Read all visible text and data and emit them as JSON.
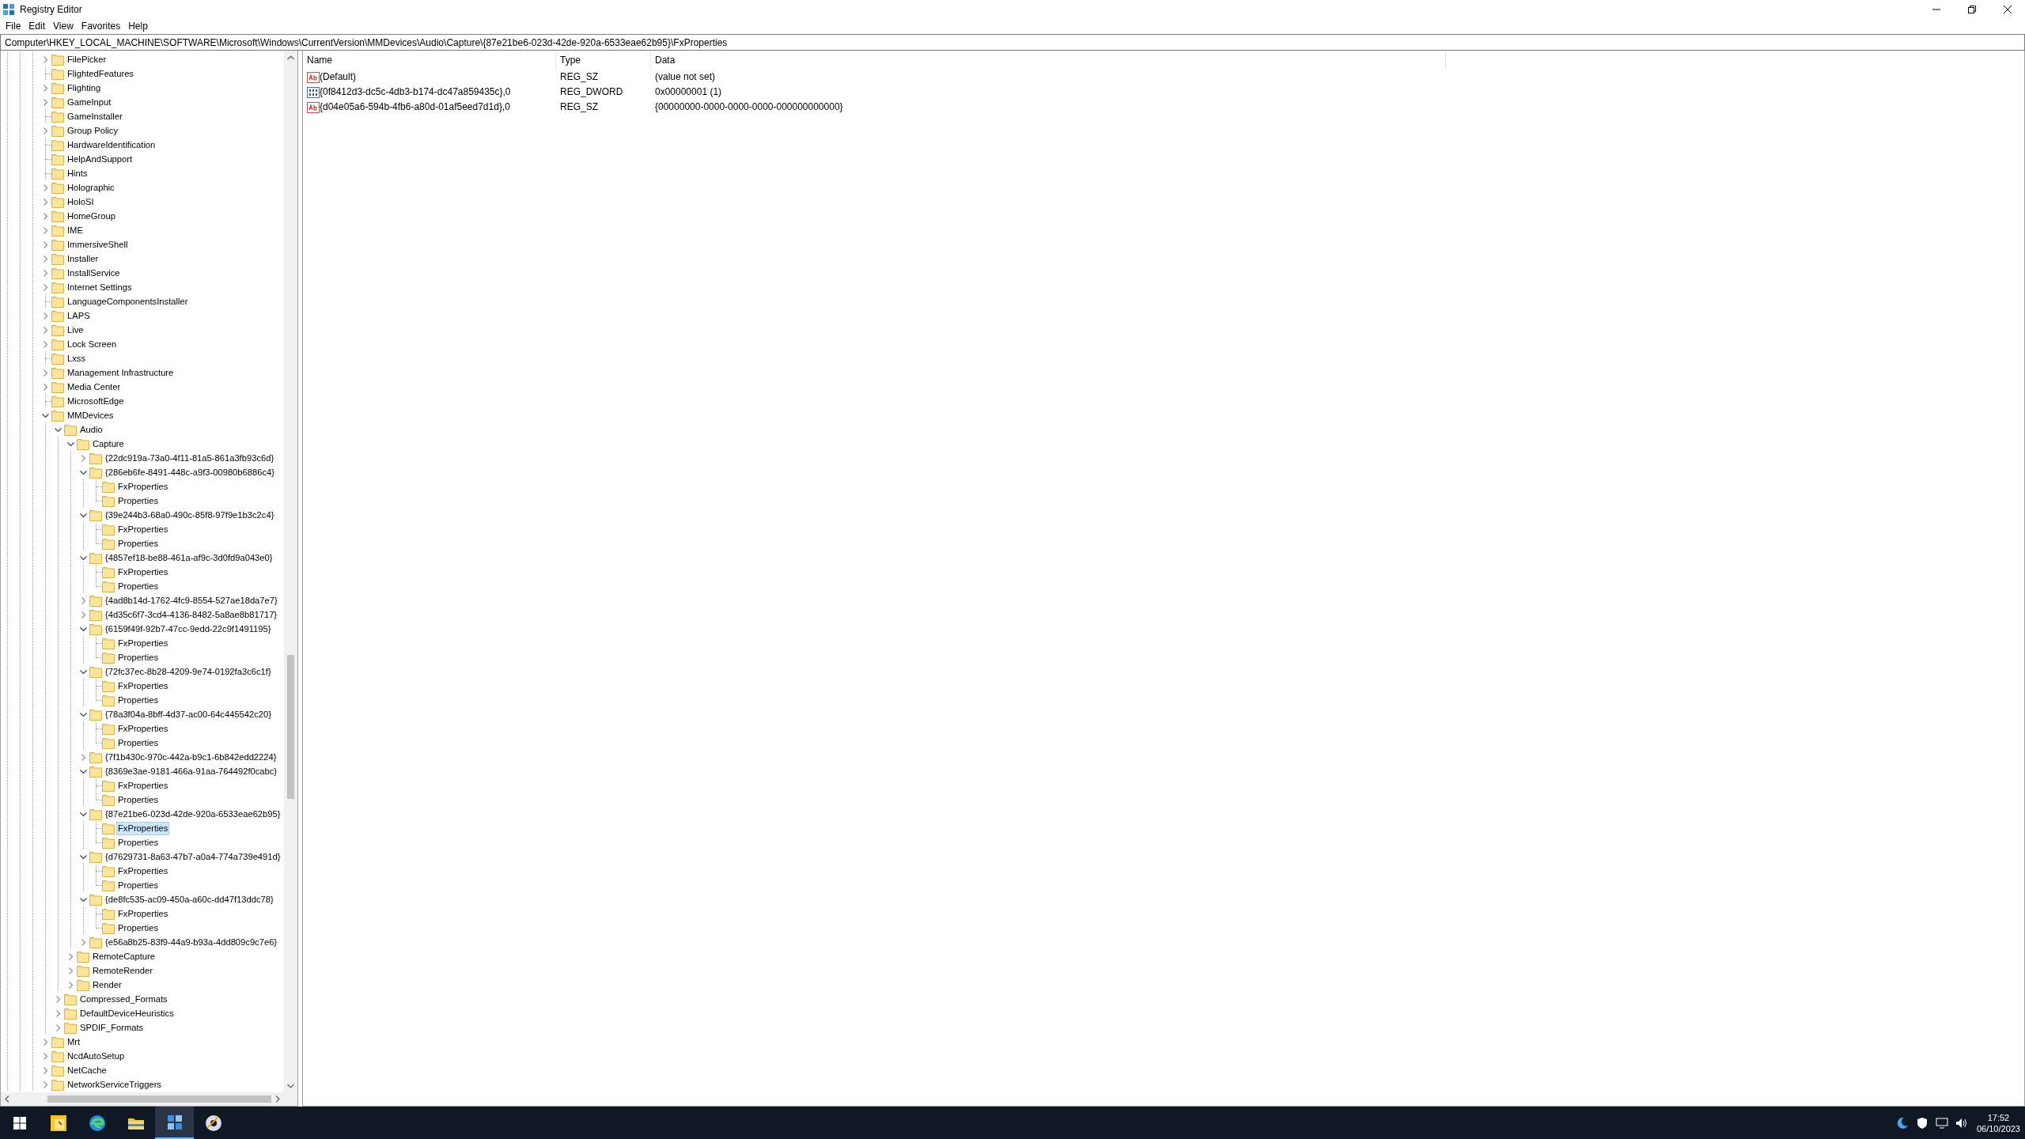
{
  "window": {
    "title": "Registry Editor"
  },
  "menu": [
    "File",
    "Edit",
    "View",
    "Favorites",
    "Help"
  ],
  "address_bar": {
    "value": "Computer\\HKEY_LOCAL_MACHINE\\SOFTWARE\\Microsoft\\Windows\\CurrentVersion\\MMDevices\\Audio\\Capture\\{87e21be6-023d-42de-920a-6533eae62b95}\\FxProperties"
  },
  "tree": {
    "items": [
      {
        "name": "FilePicker",
        "kind": "branch",
        "expanded": false,
        "selected": false
      },
      {
        "name": "FlightedFeatures",
        "kind": "leaf",
        "selected": false
      },
      {
        "name": "Flighting",
        "kind": "branch",
        "expanded": false,
        "selected": false
      },
      {
        "name": "GameInput",
        "kind": "branch",
        "expanded": false,
        "selected": false
      },
      {
        "name": "GameInstaller",
        "kind": "leaf",
        "selected": false
      },
      {
        "name": "Group Policy",
        "kind": "branch",
        "expanded": false,
        "selected": false
      },
      {
        "name": "HardwareIdentification",
        "kind": "leaf",
        "selected": false
      },
      {
        "name": "HelpAndSupport",
        "kind": "leaf",
        "selected": false
      },
      {
        "name": "Hints",
        "kind": "leaf",
        "selected": false
      },
      {
        "name": "Holographic",
        "kind": "branch",
        "expanded": false,
        "selected": false
      },
      {
        "name": "HoloSI",
        "kind": "branch",
        "expanded": false,
        "selected": false
      },
      {
        "name": "HomeGroup",
        "kind": "branch",
        "expanded": false,
        "selected": false
      },
      {
        "name": "IME",
        "kind": "branch",
        "expanded": false,
        "selected": false
      },
      {
        "name": "ImmersiveShell",
        "kind": "branch",
        "expanded": false,
        "selected": false
      },
      {
        "name": "Installer",
        "kind": "branch",
        "expanded": false,
        "selected": false
      },
      {
        "name": "InstallService",
        "kind": "branch",
        "expanded": false,
        "selected": false
      },
      {
        "name": "Internet Settings",
        "kind": "branch",
        "expanded": false,
        "selected": false
      },
      {
        "name": "LanguageComponentsInstaller",
        "kind": "leaf",
        "selected": false
      },
      {
        "name": "LAPS",
        "kind": "branch",
        "expanded": false,
        "selected": false
      },
      {
        "name": "Live",
        "kind": "branch",
        "expanded": false,
        "selected": false
      },
      {
        "name": "Lock Screen",
        "kind": "branch",
        "expanded": false,
        "selected": false
      },
      {
        "name": "Lxss",
        "kind": "leaf",
        "selected": false
      },
      {
        "name": "Management Infrastructure",
        "kind": "branch",
        "expanded": false,
        "selected": false
      },
      {
        "name": "Media Center",
        "kind": "branch",
        "expanded": false,
        "selected": false
      },
      {
        "name": "MicrosoftEdge",
        "kind": "leaf",
        "selected": false
      },
      {
        "name": "MMDevices",
        "kind": "branch",
        "expanded": true,
        "selected": false,
        "children": [
          {
            "name": "Audio",
            "kind": "branch",
            "expanded": true,
            "selected": false,
            "children": [
              {
                "name": "Capture",
                "kind": "branch",
                "expanded": true,
                "selected": false,
                "children": [
                  {
                    "name": "{22dc919a-73a0-4f11-81a5-861a3fb93c6d}",
                    "kind": "branch",
                    "expanded": false,
                    "selected": false
                  },
                  {
                    "name": "{286eb6fe-8491-448c-a9f3-00980b6886c4}",
                    "kind": "branch",
                    "expanded": true,
                    "selected": false,
                    "children": [
                      {
                        "name": "FxProperties",
                        "kind": "leaf",
                        "selected": false
                      },
                      {
                        "name": "Properties",
                        "kind": "leaf",
                        "selected": false
                      }
                    ]
                  },
                  {
                    "name": "{39e244b3-68a0-490c-85f8-97f9e1b3c2c4}",
                    "kind": "branch",
                    "expanded": true,
                    "selected": false,
                    "children": [
                      {
                        "name": "FxProperties",
                        "kind": "leaf",
                        "selected": false
                      },
                      {
                        "name": "Properties",
                        "kind": "leaf",
                        "selected": false
                      }
                    ]
                  },
                  {
                    "name": "{4857ef18-be88-461a-af9c-3d0fd9a043e0}",
                    "kind": "branch",
                    "expanded": true,
                    "selected": false,
                    "children": [
                      {
                        "name": "FxProperties",
                        "kind": "leaf",
                        "selected": false
                      },
                      {
                        "name": "Properties",
                        "kind": "leaf",
                        "selected": false
                      }
                    ]
                  },
                  {
                    "name": "{4ad8b14d-1762-4fc9-8554-527ae18da7e7}",
                    "kind": "branch",
                    "expanded": false,
                    "selected": false
                  },
                  {
                    "name": "{4d35c6f7-3cd4-4136-8482-5a8ae8b81717}",
                    "kind": "branch",
                    "expanded": false,
                    "selected": false
                  },
                  {
                    "name": "{6159f49f-92b7-47cc-9edd-22c9f1491195}",
                    "kind": "branch",
                    "expanded": true,
                    "selected": false,
                    "children": [
                      {
                        "name": "FxProperties",
                        "kind": "leaf",
                        "selected": false
                      },
                      {
                        "name": "Properties",
                        "kind": "leaf",
                        "selected": false
                      }
                    ]
                  },
                  {
                    "name": "{72fc37ec-8b28-4209-9e74-0192fa3c6c1f}",
                    "kind": "branch",
                    "expanded": true,
                    "selected": false,
                    "children": [
                      {
                        "name": "FxProperties",
                        "kind": "leaf",
                        "selected": false
                      },
                      {
                        "name": "Properties",
                        "kind": "leaf",
                        "selected": false
                      }
                    ]
                  },
                  {
                    "name": "{78a3f04a-8bff-4d37-ac00-64c445542c20}",
                    "kind": "branch",
                    "expanded": true,
                    "selected": false,
                    "children": [
                      {
                        "name": "FxProperties",
                        "kind": "leaf",
                        "selected": false
                      },
                      {
                        "name": "Properties",
                        "kind": "leaf",
                        "selected": false
                      }
                    ]
                  },
                  {
                    "name": "{7f1b430c-970c-442a-b9c1-6b842edd2224}",
                    "kind": "branch",
                    "expanded": false,
                    "selected": false
                  },
                  {
                    "name": "{8369e3ae-9181-466a-91aa-764492f0cabc}",
                    "kind": "branch",
                    "expanded": true,
                    "selected": false,
                    "children": [
                      {
                        "name": "FxProperties",
                        "kind": "leaf",
                        "selected": false
                      },
                      {
                        "name": "Properties",
                        "kind": "leaf",
                        "selected": false
                      }
                    ]
                  },
                  {
                    "name": "{87e21be6-023d-42de-920a-6533eae62b95}",
                    "kind": "branch",
                    "expanded": true,
                    "selected": false,
                    "children": [
                      {
                        "name": "FxProperties",
                        "kind": "leaf",
                        "selected": true
                      },
                      {
                        "name": "Properties",
                        "kind": "leaf",
                        "selected": false
                      }
                    ]
                  },
                  {
                    "name": "{d7629731-8a63-47b7-a0a4-774a739e491d}",
                    "kind": "branch",
                    "expanded": true,
                    "selected": false,
                    "children": [
                      {
                        "name": "FxProperties",
                        "kind": "leaf",
                        "selected": false
                      },
                      {
                        "name": "Properties",
                        "kind": "leaf",
                        "selected": false
                      }
                    ]
                  },
                  {
                    "name": "{de8fc535-ac09-450a-a60c-dd47f13ddc78}",
                    "kind": "branch",
                    "expanded": true,
                    "selected": false,
                    "children": [
                      {
                        "name": "FxProperties",
                        "kind": "leaf",
                        "selected": false
                      },
                      {
                        "name": "Properties",
                        "kind": "leaf",
                        "selected": false
                      }
                    ]
                  },
                  {
                    "name": "{e56a8b25-83f9-44a9-b93a-4dd809c9c7e6}",
                    "kind": "branch",
                    "expanded": false,
                    "selected": false
                  }
                ]
              },
              {
                "name": "RemoteCapture",
                "kind": "branch",
                "expanded": false,
                "selected": false
              },
              {
                "name": "RemoteRender",
                "kind": "branch",
                "expanded": false,
                "selected": false
              },
              {
                "name": "Render",
                "kind": "branch",
                "expanded": false,
                "selected": false
              }
            ]
          },
          {
            "name": "Compressed_Formats",
            "kind": "branch",
            "expanded": false,
            "selected": false
          },
          {
            "name": "DefaultDeviceHeuristics",
            "kind": "branch",
            "expanded": false,
            "selected": false
          },
          {
            "name": "SPDIF_Formats",
            "kind": "branch",
            "expanded": false,
            "selected": false
          }
        ]
      },
      {
        "name": "Mrt",
        "kind": "branch",
        "expanded": false,
        "selected": false
      },
      {
        "name": "NcdAutoSetup",
        "kind": "branch",
        "expanded": false,
        "selected": false
      },
      {
        "name": "NetCache",
        "kind": "branch",
        "expanded": false,
        "selected": false
      },
      {
        "name": "NetworkServiceTriggers",
        "kind": "branch",
        "expanded": false,
        "selected": false
      }
    ]
  },
  "values": {
    "columns": [
      "Name",
      "Type",
      "Data"
    ],
    "rows": [
      {
        "kind": "string",
        "name": "(Default)",
        "type": "REG_SZ",
        "data": "(value not set)"
      },
      {
        "kind": "dword",
        "name": "{0f8412d3-dc5c-4db3-b174-dc47a859435c},0",
        "type": "REG_DWORD",
        "data": "0x00000001 (1)"
      },
      {
        "kind": "string",
        "name": "{d04e05a6-594b-4fb6-a80d-01af5eed7d1d},0",
        "type": "REG_SZ",
        "data": "{00000000-0000-0000-0000-000000000000}"
      }
    ]
  },
  "taskbar": {
    "apps": [
      {
        "kind": "note",
        "selected": false
      },
      {
        "kind": "browser",
        "selected": false
      },
      {
        "kind": "folder",
        "selected": false
      },
      {
        "kind": "registry",
        "selected": true
      },
      {
        "kind": "disc",
        "selected": false
      }
    ],
    "time": "17:52",
    "date": "06/10/2023"
  }
}
